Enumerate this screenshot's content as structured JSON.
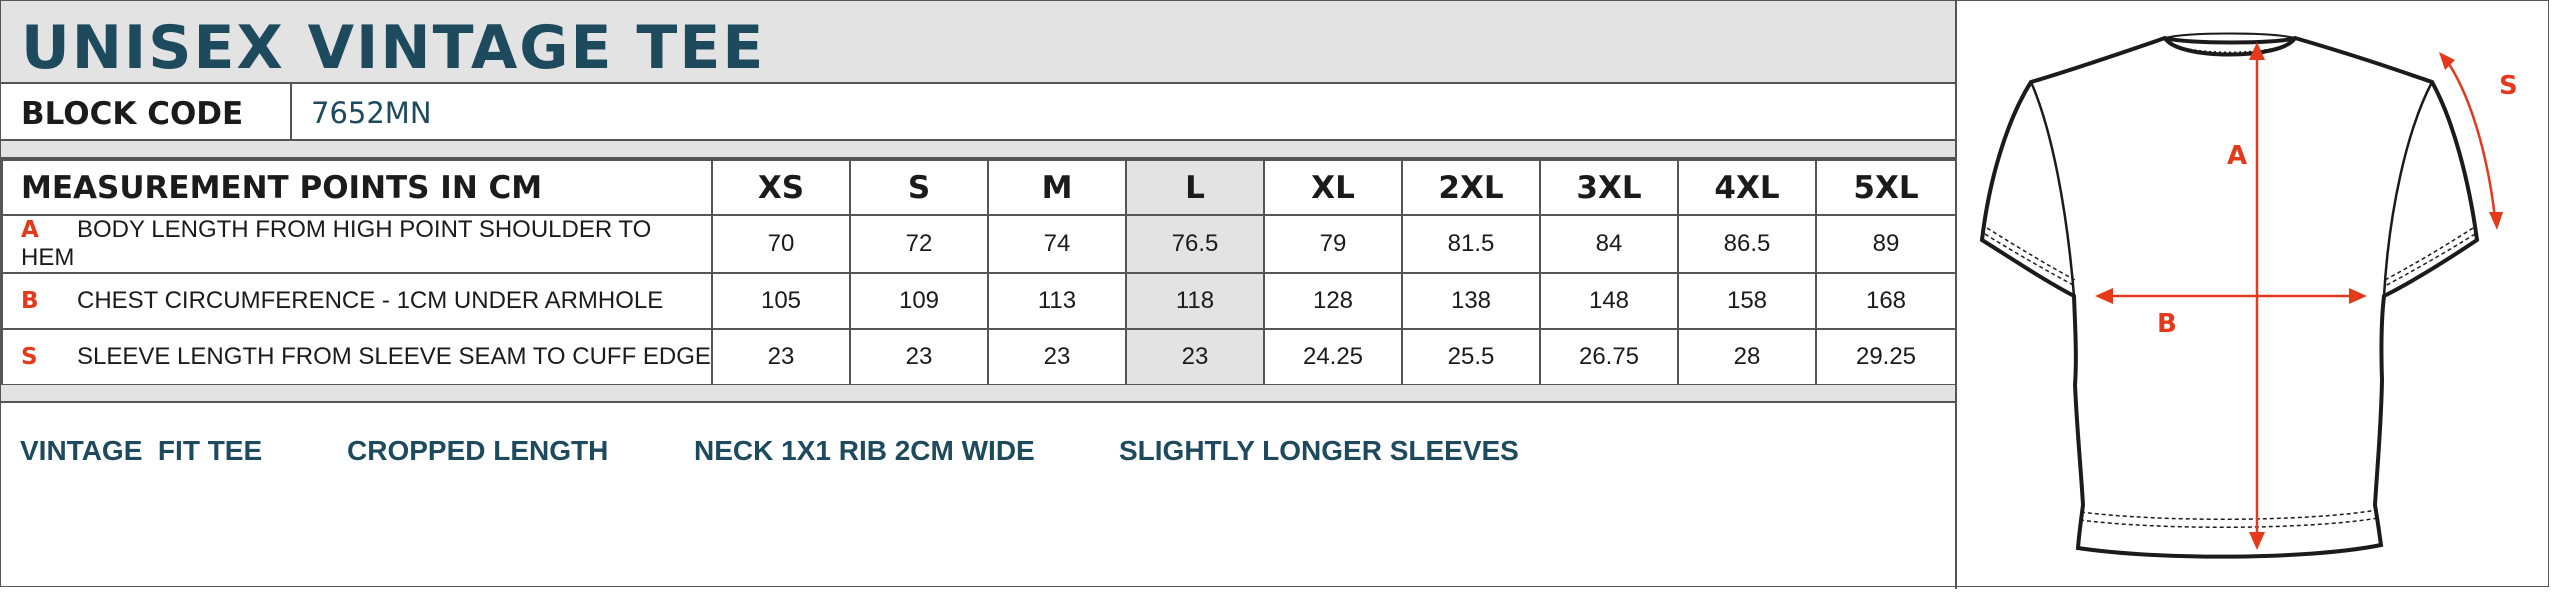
{
  "title": "UNISEX VINTAGE TEE",
  "block_code": {
    "label": "BLOCK CODE",
    "value": "7652MN"
  },
  "table": {
    "header_label": "MEASUREMENT POINTS IN CM",
    "sizes": [
      "XS",
      "S",
      "M",
      "L",
      "XL",
      "2XL",
      "3XL",
      "4XL",
      "5XL"
    ],
    "highlighted_size": "L",
    "rows": [
      {
        "letter": "A",
        "description": "BODY LENGTH FROM HIGH POINT SHOULDER TO HEM",
        "values": [
          "70",
          "72",
          "74",
          "76.5",
          "79",
          "81.5",
          "84",
          "86.5",
          "89"
        ]
      },
      {
        "letter": "B",
        "description": "CHEST CIRCUMFERENCE - 1CM UNDER ARMHOLE",
        "values": [
          "105",
          "109",
          "113",
          "118",
          "128",
          "138",
          "148",
          "158",
          "168"
        ]
      },
      {
        "letter": "S",
        "description": "SLEEVE LENGTH FROM SLEEVE SEAM TO CUFF EDGE",
        "values": [
          "23",
          "23",
          "23",
          "23",
          "24.25",
          "25.5",
          "26.75",
          "28",
          "29.25"
        ]
      }
    ]
  },
  "features": [
    "VINTAGE  FIT TEE",
    "CROPPED LENGTH",
    "NECK 1X1 RIB 2CM WIDE",
    "SLIGHTLY LONGER SLEEVES"
  ],
  "diagram": {
    "label_a": "A",
    "label_b": "B",
    "label_s": "S"
  },
  "colors": {
    "title": "#1e4a5e",
    "band": "#e3e3e3",
    "accent": "#e43a1c",
    "border": "#555555"
  }
}
